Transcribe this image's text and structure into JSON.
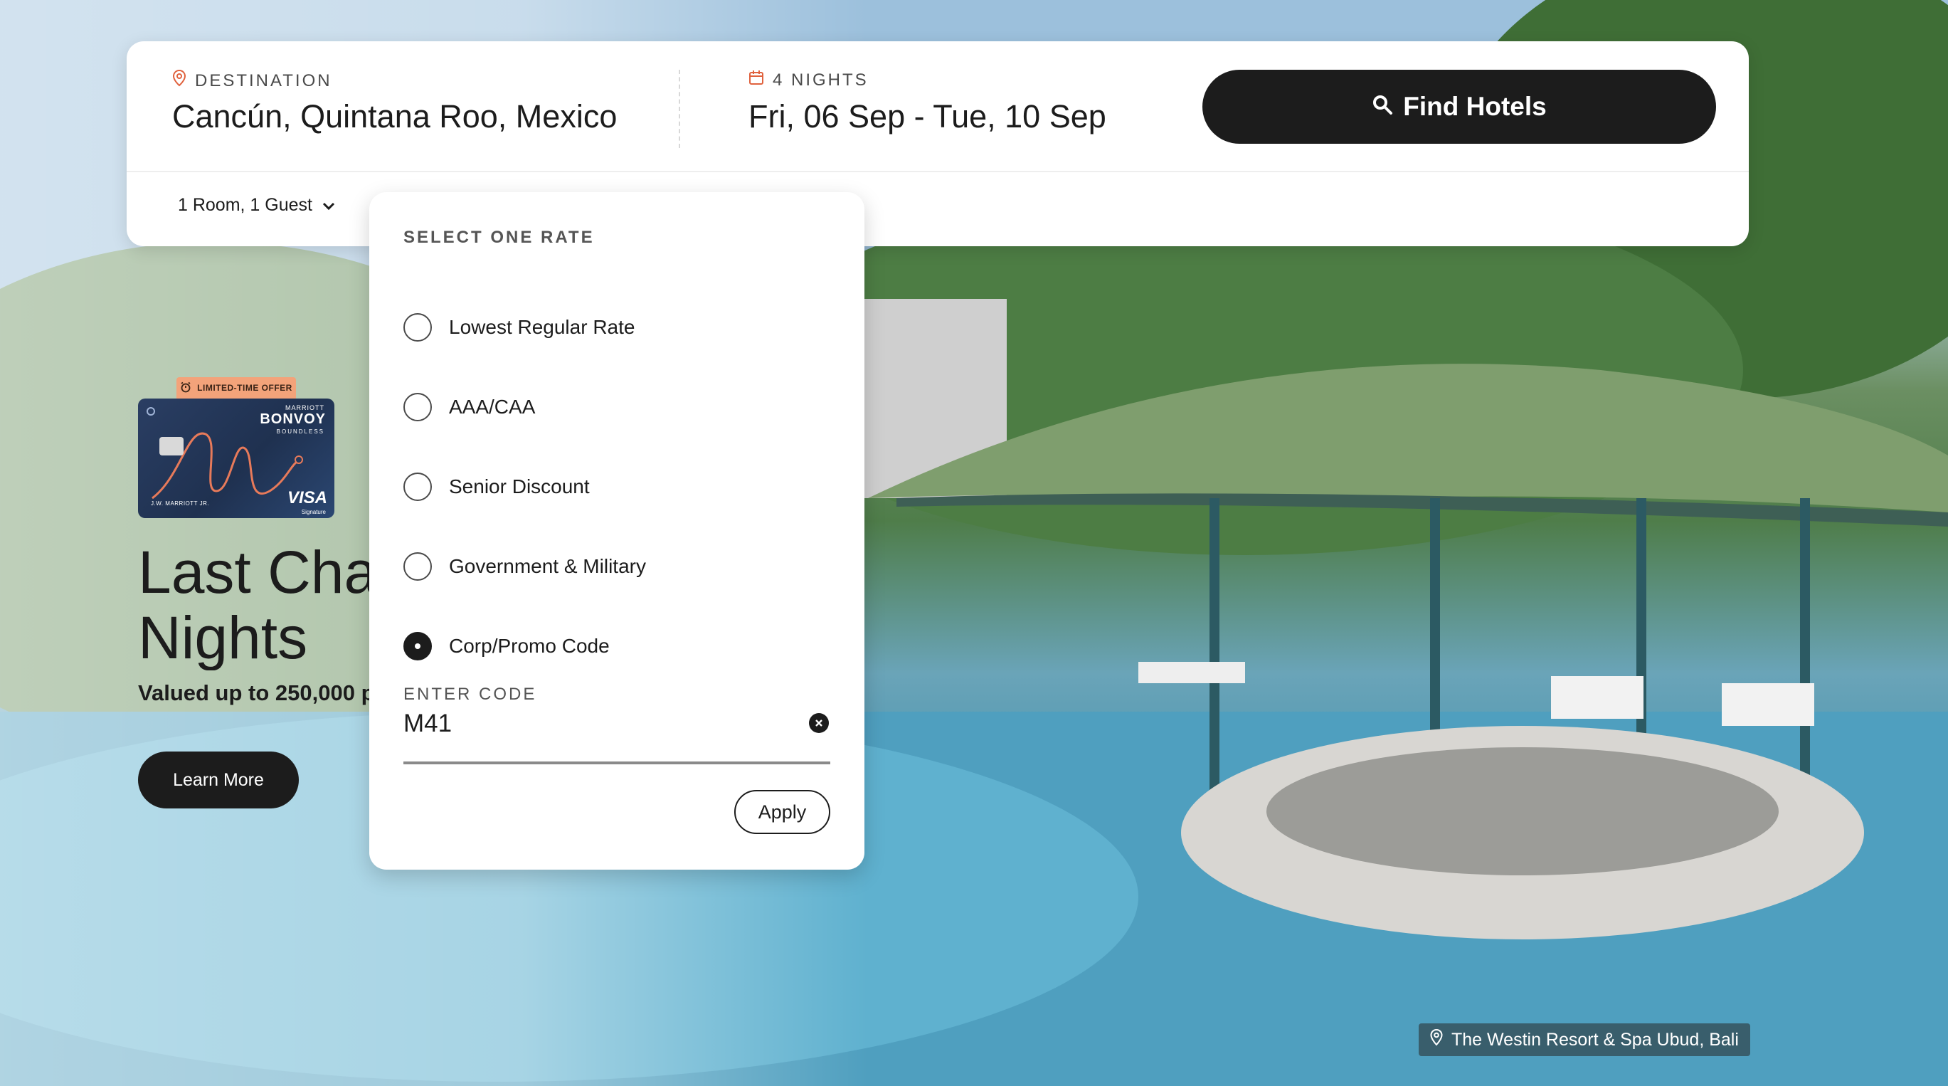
{
  "search": {
    "destination_label": "DESTINATION",
    "destination_value": "Cancún, Quintana Roo, Mexico",
    "dates_label": "4 NIGHTS",
    "dates_value": "Fri, 06 Sep - Tue, 10 Sep",
    "find_button": "Find Hotels",
    "rooms_guests": "1 Room, 1 Guest"
  },
  "rate_panel": {
    "title": "SELECT ONE RATE",
    "options": [
      {
        "label": "Lowest Regular Rate",
        "selected": false
      },
      {
        "label": "AAA/CAA",
        "selected": false
      },
      {
        "label": "Senior Discount",
        "selected": false
      },
      {
        "label": "Government & Military",
        "selected": false
      },
      {
        "label": "Corp/Promo Code",
        "selected": true
      }
    ],
    "code_label": "ENTER CODE",
    "code_value": "M41",
    "apply_button": "Apply"
  },
  "promo": {
    "badge": "LIMITED-TIME OFFER",
    "card": {
      "brand_top": "MARRIOTT",
      "brand": "BONVOY",
      "brand_sub": "BOUNDLESS",
      "holder": "J.W. MARRIOTT JR.",
      "network": "VISA",
      "network_sub": "Signature"
    },
    "title": "Last Chance Nights",
    "subtitle": "Valued up to 250,000 p",
    "learn_more": "Learn More"
  },
  "location_caption": "The Westin Resort & Spa Ubud, Bali",
  "colors": {
    "dark": "#1c1c1c",
    "accent_icon": "#e0623e",
    "badge": "#f3a37a",
    "card": "#1f3150"
  },
  "icons": [
    "location-pin-icon",
    "calendar-icon",
    "search-icon",
    "chevron-down-icon",
    "clear-icon",
    "alarm-clock-icon"
  ]
}
